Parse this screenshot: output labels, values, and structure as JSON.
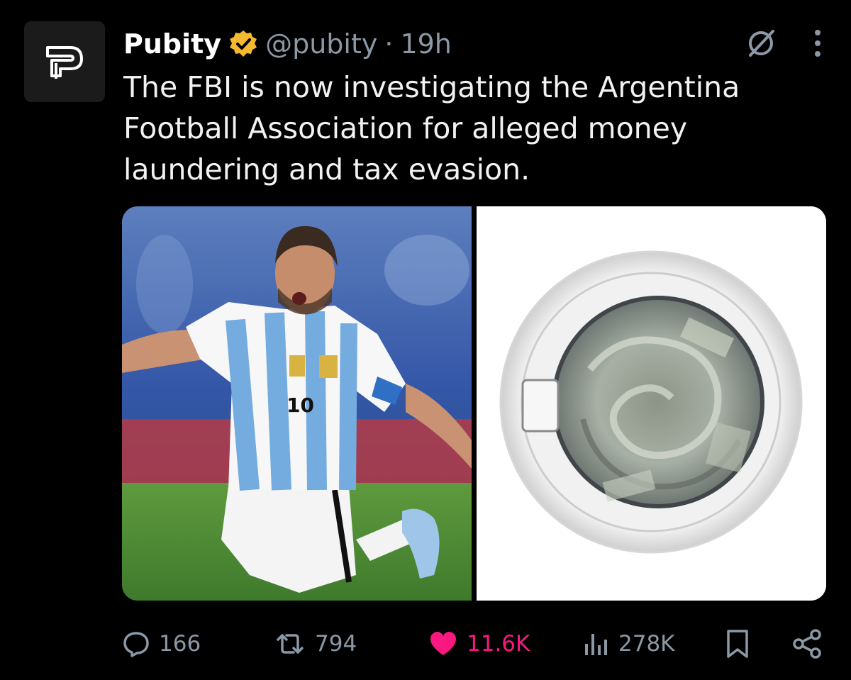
{
  "account": {
    "display_name": "Pubity",
    "handle": "@pubity",
    "separator": "·",
    "time": "19h",
    "avatar_icon": "pubity-logo",
    "verified_icon": "verified-badge-icon",
    "verified_color": "#f5b82e"
  },
  "tweet": {
    "text": "The FBI is now investigating the Argentina Football Association for alleged money laundering and tax evasion."
  },
  "media": {
    "left_image": "footballer-in-argentina-jersey-celebrating",
    "right_image": "washing-machine-drum-with-banknotes"
  },
  "jersey": {
    "number": "10"
  },
  "actions": {
    "reply_count": "166",
    "repost_count": "794",
    "like_count": "11.6K",
    "view_count": "278K",
    "like_color": "#f91880"
  }
}
